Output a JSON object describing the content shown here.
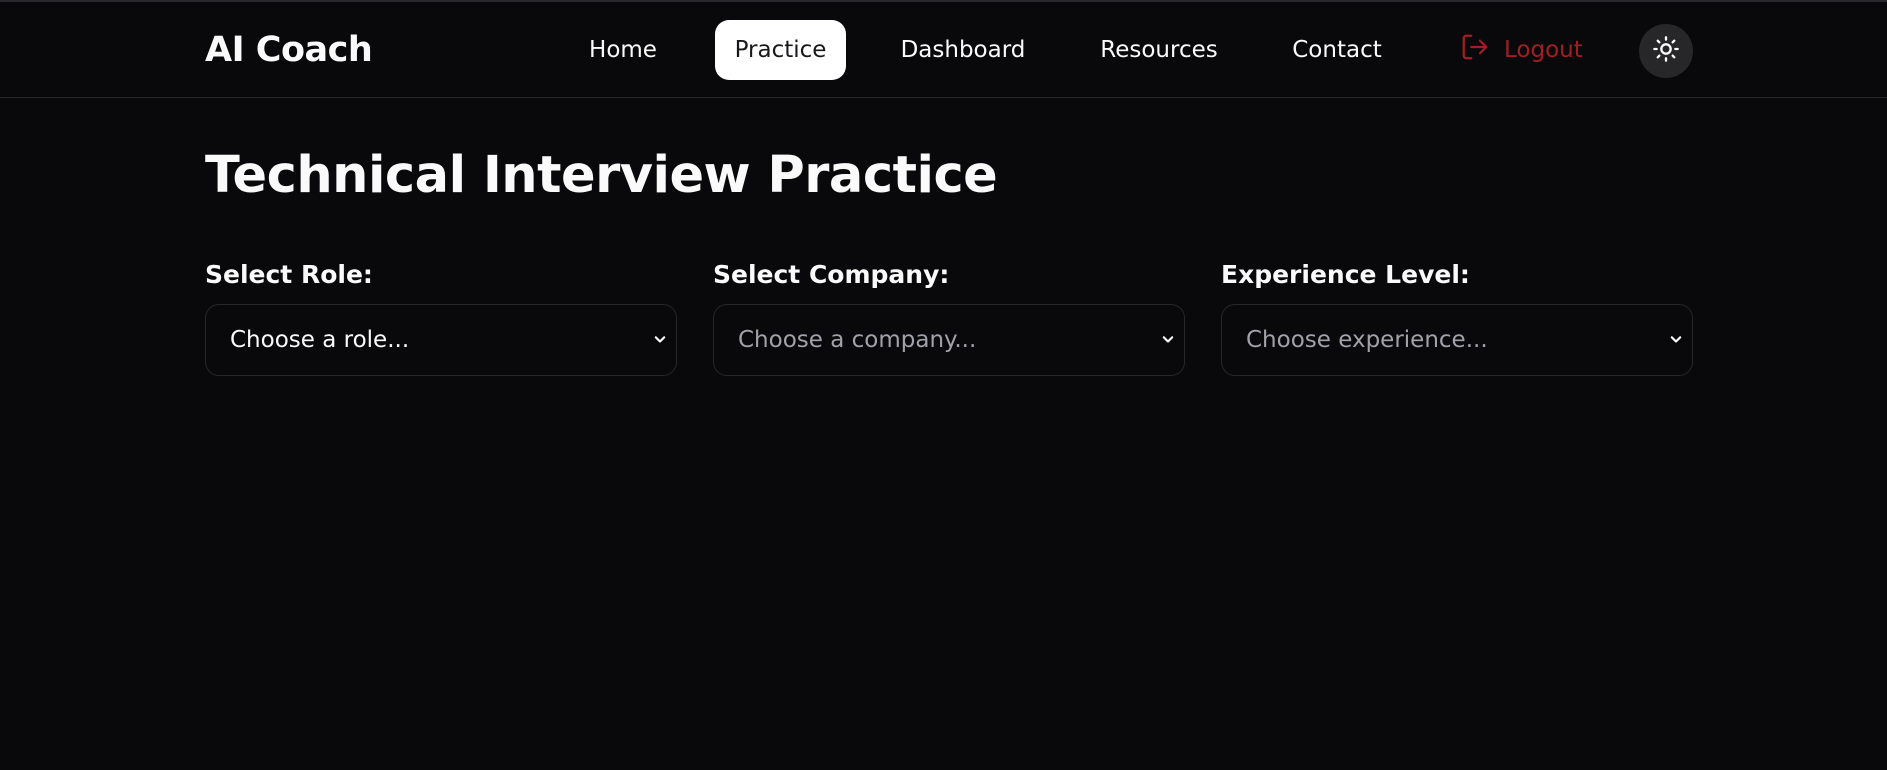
{
  "header": {
    "brand": "AI Coach",
    "nav": [
      {
        "label": "Home",
        "active": false
      },
      {
        "label": "Practice",
        "active": true
      },
      {
        "label": "Dashboard",
        "active": false
      },
      {
        "label": "Resources",
        "active": false
      },
      {
        "label": "Contact",
        "active": false
      }
    ],
    "logout_label": "Logout",
    "theme_toggle_icon": "sun-icon",
    "logout_icon": "logout-icon"
  },
  "main": {
    "title": "Technical Interview Practice",
    "fields": [
      {
        "label": "Select Role:",
        "placeholder": "Choose a role..."
      },
      {
        "label": "Select Company:",
        "placeholder": "Choose a company..."
      },
      {
        "label": "Experience Level:",
        "placeholder": "Choose experience..."
      }
    ]
  },
  "colors": {
    "background": "#09090b",
    "active_nav_bg": "#ffffff",
    "logout": "#a01f24",
    "border": "#27272a"
  }
}
